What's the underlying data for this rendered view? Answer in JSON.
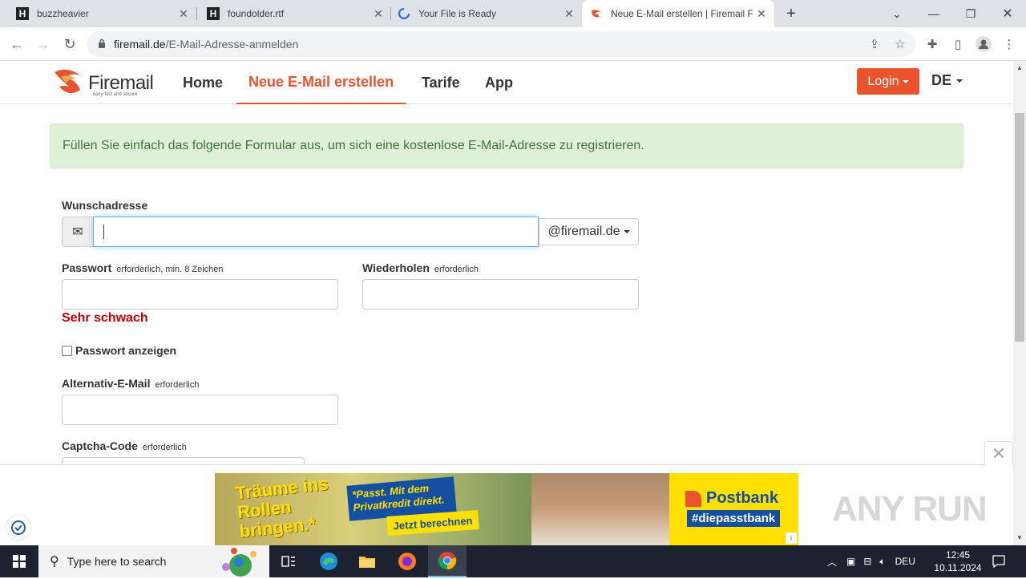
{
  "browser": {
    "tabs": [
      {
        "title": "buzzheavier",
        "icon": "h-logo-icon"
      },
      {
        "title": "foundolder.rtf",
        "icon": "h-logo-icon"
      },
      {
        "title": "Your File is Ready",
        "icon": "loading-spinner-icon"
      },
      {
        "title": "Neue E-Mail erstellen | Firemail F",
        "icon": "firemail-icon",
        "active": true
      }
    ],
    "url_host": "firemail.de",
    "url_path": "/E-Mail-Adresse-anmelden"
  },
  "site": {
    "logo_text": "Firemail",
    "logo_tagline": "easy fast and secure",
    "nav": [
      "Home",
      "Neue E-Mail erstellen",
      "Tarife",
      "App"
    ],
    "active_nav": "Neue E-Mail erstellen",
    "login_label": "Login",
    "language": "DE",
    "accent_color": "#e8542e"
  },
  "alert": {
    "text": "Füllen Sie einfach das folgende Formular aus, um sich eine kostenlose E-Mail-Adresse zu registrieren."
  },
  "form": {
    "address_label": "Wunschadresse",
    "address_value": "",
    "domain": "@firemail.de",
    "password_label": "Passwort",
    "password_hint": "erforderlich, min. 8 Zeichen",
    "repeat_label": "Wiederholen",
    "repeat_hint": "erforderlich",
    "strength": "Sehr schwach",
    "show_password_label": "Passwort anzeigen",
    "show_password_checked": false,
    "alt_email_label": "Alternativ-E-Mail",
    "alt_email_hint": "erforderlich",
    "captcha_label": "Captcha-Code",
    "captcha_hint": "erforderlich"
  },
  "ad": {
    "headline": "Träume ins Rollen bringen.*",
    "tagline": "*Passt. Mit dem Privatkredit direkt.",
    "cta": "Jetzt berechnen",
    "brand": "Postbank",
    "hashtag": "#diepasstbank",
    "info": "i"
  },
  "watermark": "ANY RUN",
  "taskbar": {
    "search_placeholder": "Type here to search",
    "language": "DEU",
    "time": "12:45",
    "date": "10.11.2024"
  }
}
